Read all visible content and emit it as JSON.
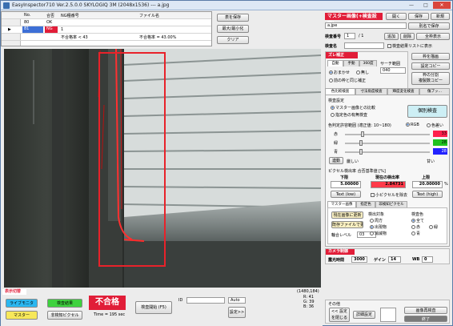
{
  "window": {
    "title": "EasyInspector710 Ver.2.5.0.0 SKYLOGIQ 3M   (2048x1536) --- a.jpg",
    "minimize": "—",
    "maximize": "□",
    "close": "✕"
  },
  "table": {
    "headers": {
      "no": "No.",
      "result": "合否",
      "ng_type": "NG種番号",
      "file": "ファイル名"
    },
    "rows": [
      {
        "no": "80",
        "result": "OK",
        "ng_type": "",
        "file": ""
      },
      {
        "no": "81",
        "result": "NG",
        "ng_type": "1",
        "file": ""
      },
      {
        "no": "",
        "result": "",
        "ng_type": "不合格率 < 43",
        "file": "不合格率 = 43.00%"
      }
    ],
    "row_marker": "▶"
  },
  "top_buttons": {
    "save_table": "表を保存",
    "maximize_list": "最大/最小化",
    "clear": "クリア"
  },
  "master": {
    "title": "マスター画像(+検査設定)",
    "open": "開く",
    "save": "保存",
    "new": "新規",
    "filename": "a.jpe",
    "save_as": "別名で保存",
    "all_save": "全枠表示",
    "inspect_no_label": "検査番号",
    "inspect_no_value": "1",
    "inspect_total": "/ 1",
    "add": "追加",
    "delete": "削除",
    "name_label": "検査名",
    "hide_list": "検査結果リストに表示"
  },
  "offset": {
    "title": "ズレ補正",
    "tabs": [
      "自動",
      "手動",
      "360度"
    ],
    "search_range_label": "サーチ範囲",
    "search_range_value": "040",
    "radio_auto": "おまかせ",
    "radio_none": "無し",
    "prev_same": "前の枠と同じ補正",
    "frame_draw": "枠を描画",
    "setting_copy": "設定コピー",
    "multi_check": "枠の分割",
    "multi_check2": "複製数コピー"
  },
  "inspection_tabs": [
    "色比較検査",
    "寸法角度検査",
    "輝度変化検査",
    "傷ブッ…"
  ],
  "color_compare": {
    "section": "検査設定",
    "radio1": "マスター画像との比較",
    "radio2": "指定色の有無検査",
    "indiv_btn": "個別検査",
    "color_range_label": "色判定許容範囲 (適正値: 10~180)",
    "rgb": "RGB",
    "color_diff": "色差い",
    "channels": [
      {
        "name": "赤",
        "value": "33",
        "color": "#ff1f4c"
      },
      {
        "name": "緑",
        "value": "28",
        "color": "#1fc21f"
      },
      {
        "name": "青",
        "value": "28",
        "color": "#2222ff"
      }
    ],
    "link": "連動",
    "strict": "厳しい",
    "loose": "甘い",
    "pixel_rate_title": "ピクセル検出率 合否基準値 [%]",
    "lower": "下限",
    "current": "現在の検出率",
    "upper": "上限",
    "lower_value": "5.00000",
    "current_value": "2.84731",
    "upper_value": "20.00000",
    "pct": "%",
    "text_low": "Text (low)",
    "small_pixel": "小ピクセルを除去",
    "text_high": "Text (high)"
  },
  "sub_tabs": [
    "マスター画像",
    "指定色",
    "非検知ピクセル"
  ],
  "master_sub": {
    "current_image_btn": "現在画像に更新",
    "file_btn": "既存ファイルで更新",
    "detect_target": "検出対象",
    "target_periphery": "周方",
    "target_emit": "出現物",
    "target_vanish": "消滅物",
    "inspect_color": "検査色",
    "color_all": "全て",
    "color_red": "赤",
    "color_green": "緑",
    "color_blue": "青",
    "contour_label": "輪合レベル",
    "contour_value": "03"
  },
  "camera": {
    "title": "カメラ制御",
    "exposure_label": "露光時間",
    "exposure_value": "3000",
    "gain_label": "ゲイン",
    "gain_value": "14",
    "wb_label": "WB",
    "wb_value": "0"
  },
  "others": {
    "title": "その他",
    "settings_btn": "<< 設定を閉じる",
    "detail_btn": "詳細設定",
    "save_image": "画像再検査",
    "end": "終了"
  },
  "bottom": {
    "display_switch": "表示切替",
    "live_monitor": "ライブモニタ",
    "inspection_result": "検査結果",
    "master": "マスター",
    "non_detect_pixel": "非検知ピクセル",
    "verdict": "不合格",
    "time": "Time = 195 sec",
    "inspect_start": "検査開始 (F5)",
    "id_label": "ID",
    "auto": "Auto",
    "settings": "設定>>",
    "coord": "(1480,184)",
    "r": "R: 41",
    "g": "G: 39",
    "b": "B: 36"
  }
}
